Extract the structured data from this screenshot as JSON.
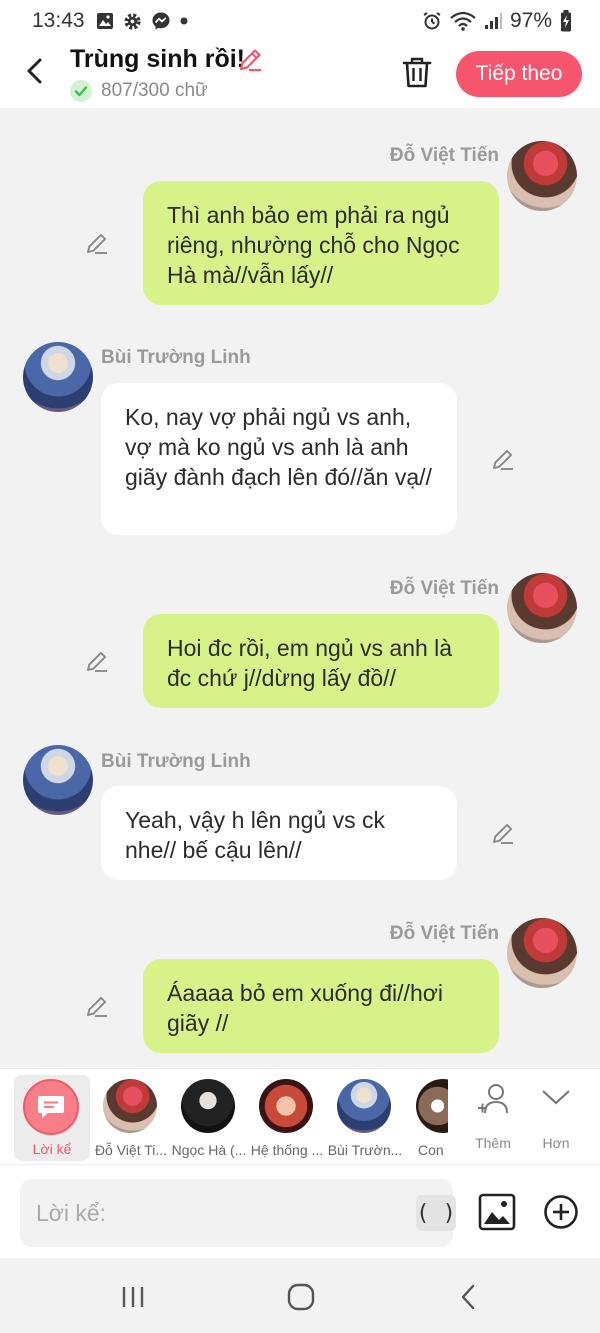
{
  "status_bar": {
    "time": "13:43",
    "battery": "97%"
  },
  "header": {
    "title": "Trùng sinh rồi!",
    "word_count": "807/300 chữ",
    "next_label": "Tiếp theo"
  },
  "colors": {
    "accent": "#f5566d",
    "bubble_green": "#d8f28a",
    "bubble_white": "#ffffff"
  },
  "messages": [
    {
      "sender": "Đỗ Việt Tiến",
      "side": "right",
      "text": "Thì anh bảo em phải ra ngủ riêng, nhường chỗ cho Ngọc Hà mà//vẫn lấy//"
    },
    {
      "sender": "Bùi Trường Linh",
      "side": "left",
      "text": "Ko, nay vợ phải ngủ vs anh, vợ mà ko ngủ vs anh là anh giãy đành đạch lên đó//ăn vạ//"
    },
    {
      "sender": "Đỗ Việt Tiến",
      "side": "right",
      "text": "Hoi đc rồi, em ngủ vs anh là đc chứ j//dừng lấy đồ//"
    },
    {
      "sender": "Bùi Trường Linh",
      "side": "left",
      "text": "Yeah, vậy h lên ngủ vs ck nhe// bế cậu lên//"
    },
    {
      "sender": "Đỗ Việt Tiến",
      "side": "right",
      "text": "Áaaaa bỏ em xuống đi//hơi giãy //"
    }
  ],
  "cast_bar": {
    "narrator_label": "Lời kể",
    "characters": [
      "Đỗ Việt Ti...",
      "Ngọc Hà (...",
      "Hệ thống ...",
      "Bùi Trườn...",
      "Con"
    ],
    "add_label": "Thêm",
    "more_label": "Hơn"
  },
  "input": {
    "placeholder": "Lời kể:",
    "paren_label": "( )"
  }
}
